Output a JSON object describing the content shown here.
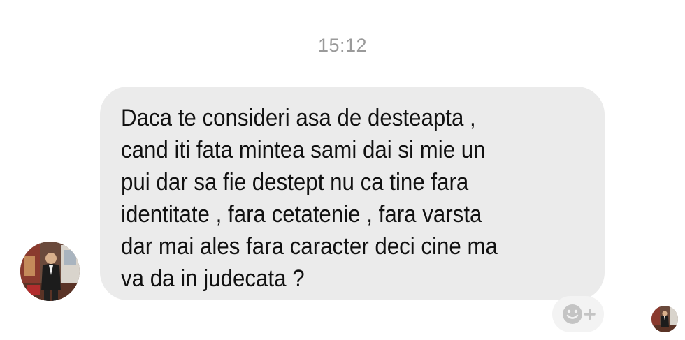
{
  "conversation": {
    "timestamp": "15:12",
    "messages": [
      {
        "direction": "incoming",
        "lines": [
          "Daca te consideri asa de desteapta ,",
          "cand iti fata mintea sami dai si mie un",
          "pui dar sa fie destept nu ca tine fara",
          "identitate , fara cetatenie , fara varsta",
          "dar mai ales fara caracter deci cine ma",
          "va da in judecata ?"
        ]
      }
    ]
  },
  "icons": {
    "sender_avatar": "avatar-photo",
    "react": "smiley-plus-icon",
    "seen": "seen-avatar-photo"
  },
  "colors": {
    "bubble_bg": "#ebebeb",
    "timestamp": "#9a9a9a",
    "text": "#111111"
  }
}
